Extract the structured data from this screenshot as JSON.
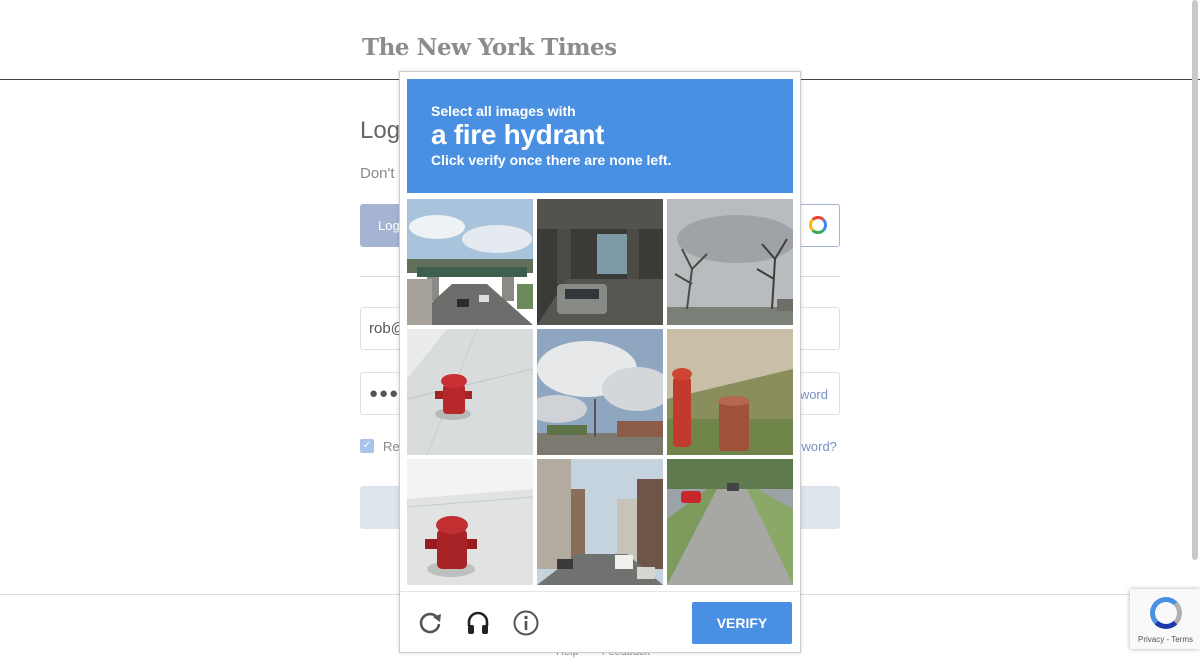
{
  "page": {
    "logo": "The New York Times",
    "login_title": "Log",
    "login_subtitle": "Don't",
    "login_button": "Log",
    "email_value": "rob@",
    "password_value": "●●●●●",
    "show_password_label": "word",
    "remember_label": "Re",
    "forgot_link": "sword?",
    "footer_links": [
      "Help",
      "Feedback"
    ]
  },
  "captcha": {
    "prompt": {
      "lead": "Select all images with",
      "object": "a fire hydrant",
      "note": "Click verify once there are none left."
    },
    "tiles": [
      {
        "subject": "highway overpass with traffic"
      },
      {
        "subject": "dark underpass with car"
      },
      {
        "subject": "bare tree and cloudy sky"
      },
      {
        "subject": "fire hydrant on sidewalk"
      },
      {
        "subject": "cloudy sky over parking lot"
      },
      {
        "subject": "fire hydrant in grass"
      },
      {
        "subject": "fire hydrant on sidewalk close-up"
      },
      {
        "subject": "city street with buildings"
      },
      {
        "subject": "residential street with red car"
      }
    ],
    "controls": {
      "reload_icon": "reload-icon",
      "audio_icon": "headphones-icon",
      "info_icon": "info-icon"
    },
    "verify_label": "VERIFY",
    "accent_color": "#4a90e2"
  },
  "recaptcha_badge": {
    "privacy": "Privacy",
    "separator": " - ",
    "terms": "Terms"
  }
}
